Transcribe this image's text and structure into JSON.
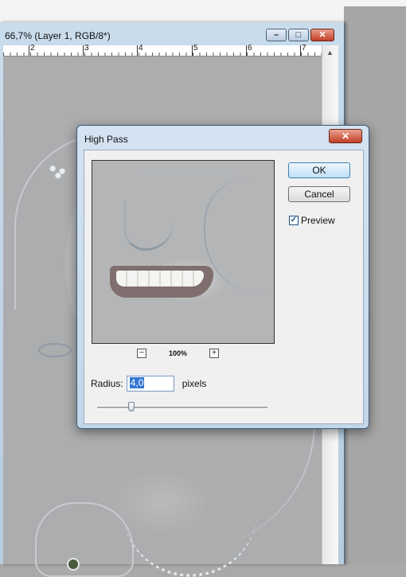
{
  "document": {
    "title": "66,7% (Layer 1, RGB/8*)",
    "window_buttons": {
      "minimize": "–",
      "maximize": "□",
      "close": "✕"
    },
    "ruler_numbers": [
      "2",
      "3",
      "4",
      "5",
      "6",
      "7"
    ]
  },
  "dialog": {
    "title": "High Pass",
    "close_glyph": "✕",
    "ok_label": "OK",
    "cancel_label": "Cancel",
    "preview_label": "Preview",
    "preview_checked": true,
    "zoom_out_glyph": "−",
    "zoom_in_glyph": "+",
    "zoom_level": "100%",
    "radius_label": "Radius:",
    "radius_value": "4,0",
    "radius_unit": "pixels",
    "radius_slider_fraction": 0.2
  },
  "colors": {
    "title_bar": "#c9dcec",
    "close_red": "#c33f27",
    "ok_blue": "#3c7fb1",
    "canvas_gray": "#acadaf"
  }
}
